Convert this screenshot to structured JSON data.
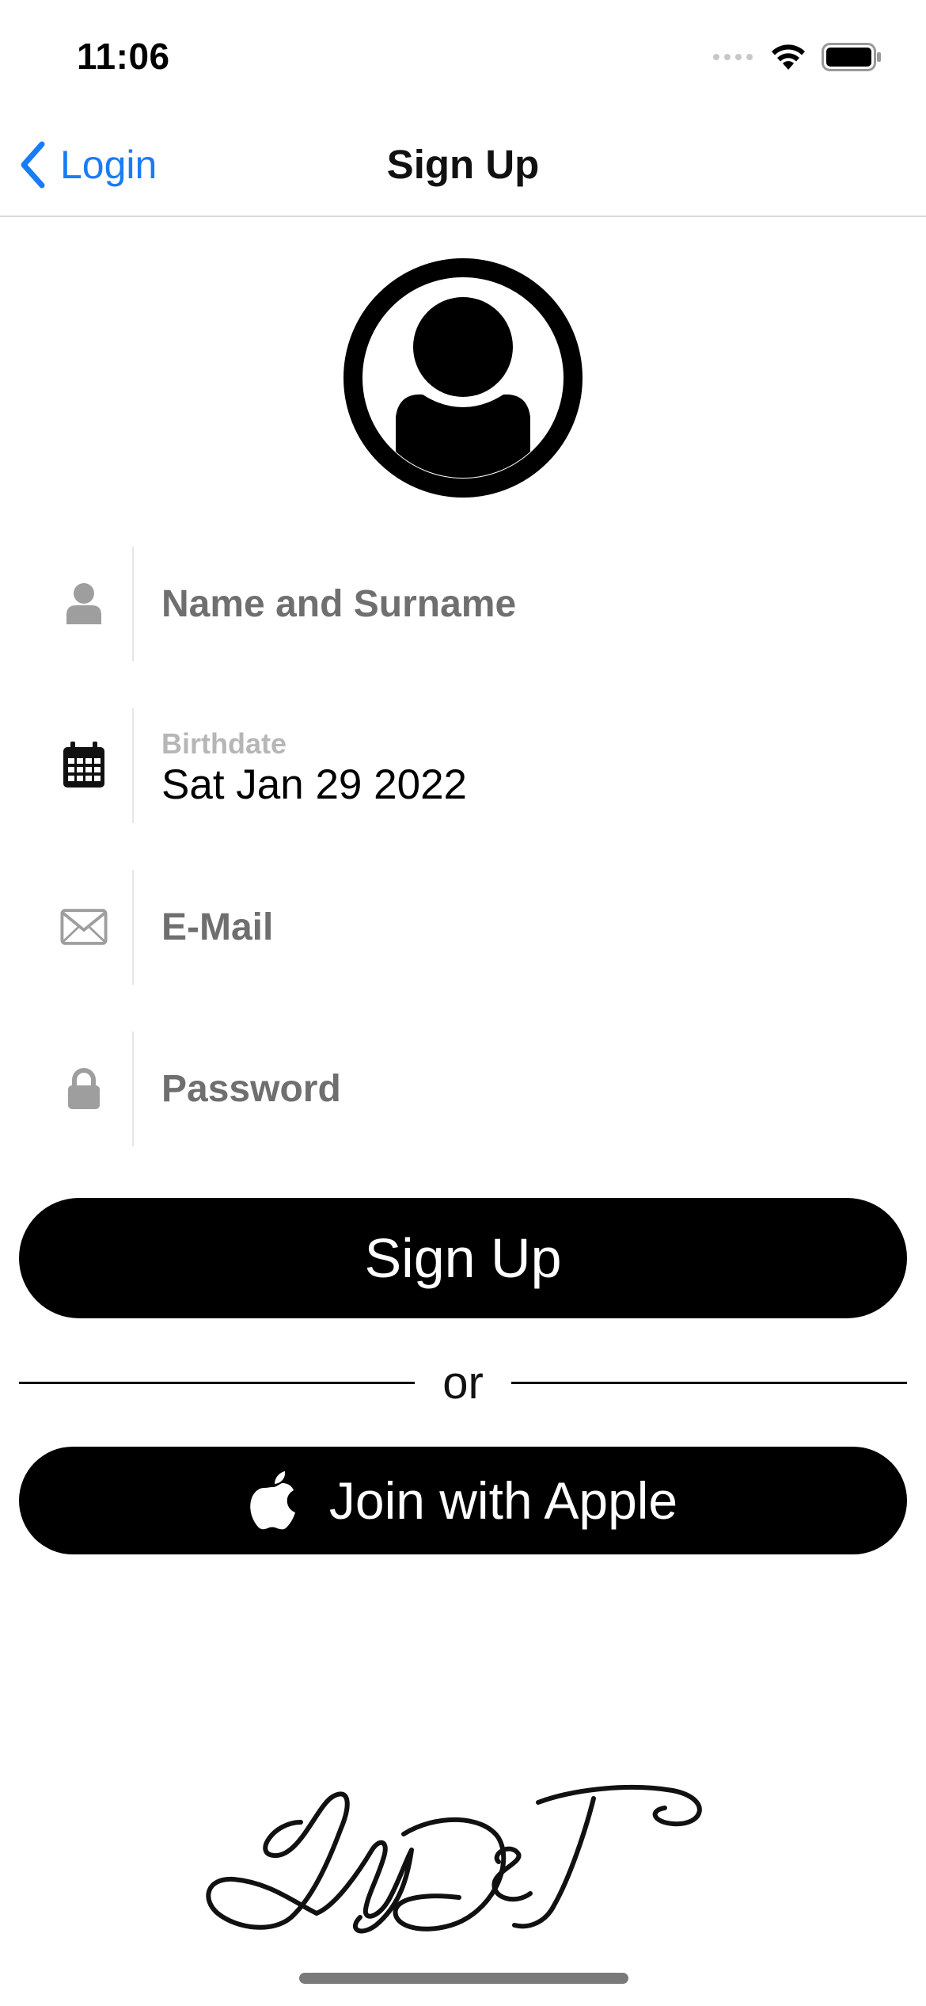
{
  "status_bar": {
    "time": "11:06"
  },
  "nav": {
    "back_label": "Login",
    "title": "Sign Up"
  },
  "form": {
    "name_placeholder": "Name and Surname",
    "birthdate_label": "Birthdate",
    "birthdate_value": "Sat Jan 29 2022",
    "email_placeholder": "E-Mail",
    "password_placeholder": "Password"
  },
  "buttons": {
    "signup_label": "Sign Up",
    "divider_text": "or",
    "apple_label": "Join with Apple"
  },
  "colors": {
    "accent": "#1a7cf5",
    "button_bg": "#000000",
    "placeholder": "#6f6f6f"
  },
  "icons": [
    "chevron-left-icon",
    "person-icon",
    "calendar-icon",
    "envelope-icon",
    "lock-icon",
    "apple-icon",
    "wifi-icon",
    "battery-icon",
    "cellular-signal-icon"
  ],
  "signature_text": "LGT"
}
